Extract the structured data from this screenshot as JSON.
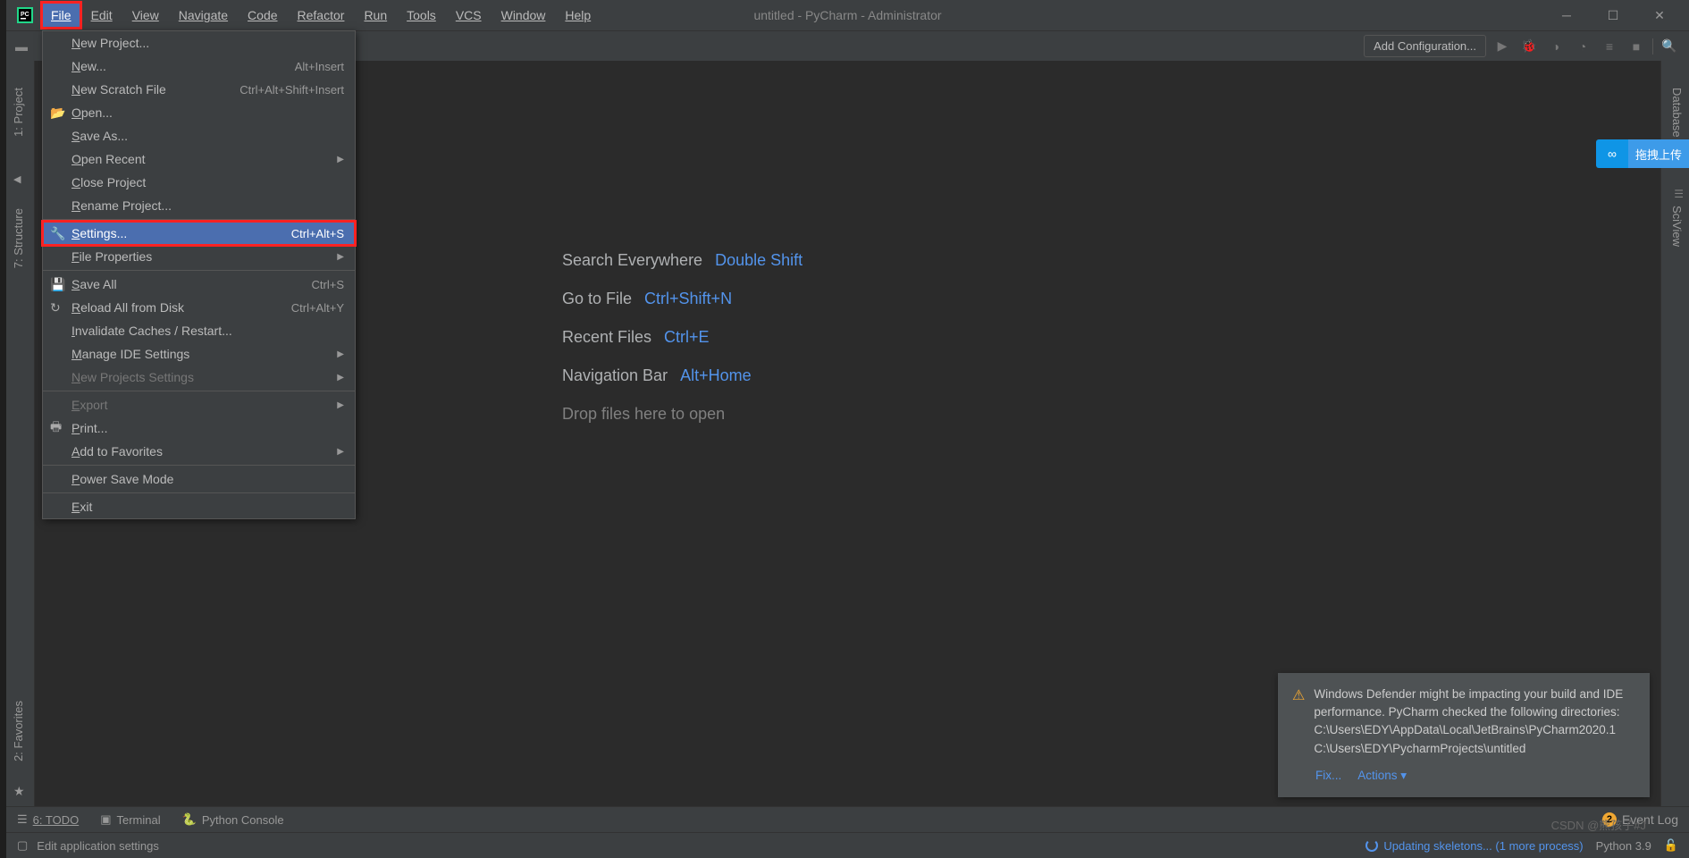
{
  "window": {
    "title": "untitled - PyCharm - Administrator"
  },
  "menubar": [
    "File",
    "Edit",
    "View",
    "Navigate",
    "Code",
    "Refactor",
    "Run",
    "Tools",
    "VCS",
    "Window",
    "Help"
  ],
  "toolbar": {
    "add_config": "Add Configuration..."
  },
  "sidebar_left": {
    "project": "1: Project",
    "structure": "7: Structure",
    "favorites": "2: Favorites"
  },
  "sidebar_right": {
    "database": "Database",
    "sciview": "SciView"
  },
  "file_menu": [
    {
      "label": "New Project...",
      "icon": "",
      "shortcut": ""
    },
    {
      "label": "New...",
      "icon": "",
      "shortcut": "Alt+Insert"
    },
    {
      "label": "New Scratch File",
      "icon": "",
      "shortcut": "Ctrl+Alt+Shift+Insert"
    },
    {
      "label": "Open...",
      "icon": "open",
      "shortcut": ""
    },
    {
      "label": "Save As...",
      "icon": "",
      "shortcut": ""
    },
    {
      "label": "Open Recent",
      "icon": "",
      "shortcut": "",
      "submenu": true
    },
    {
      "label": "Close Project",
      "icon": "",
      "shortcut": ""
    },
    {
      "label": "Rename Project...",
      "icon": "",
      "shortcut": ""
    },
    {
      "sep": true
    },
    {
      "label": "Settings...",
      "icon": "wrench",
      "shortcut": "Ctrl+Alt+S",
      "highlighted": true,
      "annotated": true
    },
    {
      "label": "File Properties",
      "icon": "",
      "shortcut": "",
      "submenu": true
    },
    {
      "sep": true
    },
    {
      "label": "Save All",
      "icon": "save",
      "shortcut": "Ctrl+S"
    },
    {
      "label": "Reload All from Disk",
      "icon": "reload",
      "shortcut": "Ctrl+Alt+Y"
    },
    {
      "label": "Invalidate Caches / Restart...",
      "icon": "",
      "shortcut": ""
    },
    {
      "label": "Manage IDE Settings",
      "icon": "",
      "shortcut": "",
      "submenu": true
    },
    {
      "label": "New Projects Settings",
      "icon": "",
      "shortcut": "",
      "submenu": true,
      "dim": true
    },
    {
      "sep": true
    },
    {
      "label": "Export",
      "icon": "",
      "shortcut": "",
      "submenu": true,
      "dim": true
    },
    {
      "label": "Print...",
      "icon": "print",
      "shortcut": ""
    },
    {
      "label": "Add to Favorites",
      "icon": "",
      "shortcut": "",
      "submenu": true
    },
    {
      "sep": true
    },
    {
      "label": "Power Save Mode",
      "icon": "",
      "shortcut": ""
    },
    {
      "sep": true
    },
    {
      "label": "Exit",
      "icon": "",
      "shortcut": ""
    }
  ],
  "welcome": {
    "rows": [
      {
        "label": "Search Everywhere",
        "shortcut": "Double Shift"
      },
      {
        "label": "Go to File",
        "shortcut": "Ctrl+Shift+N"
      },
      {
        "label": "Recent Files",
        "shortcut": "Ctrl+E"
      },
      {
        "label": "Navigation Bar",
        "shortcut": "Alt+Home"
      }
    ],
    "drop": "Drop files here to open"
  },
  "notification": {
    "text": "Windows Defender might be impacting your build and IDE performance. PyCharm checked the following directories:\nC:\\Users\\EDY\\AppData\\Local\\JetBrains\\PyCharm2020.1\nC:\\Users\\EDY\\PycharmProjects\\untitled",
    "fix": "Fix...",
    "actions": "Actions"
  },
  "bottom": {
    "todo": "6: TODO",
    "terminal": "Terminal",
    "console": "Python Console",
    "event_log": "Event Log",
    "event_count": "2"
  },
  "status": {
    "hint": "Edit application settings",
    "updating": "Updating skeletons... (1 more process)",
    "python": "Python 3.9"
  },
  "float": {
    "text": "拖拽上传"
  },
  "watermark": "CSDN @熊孩子#J"
}
